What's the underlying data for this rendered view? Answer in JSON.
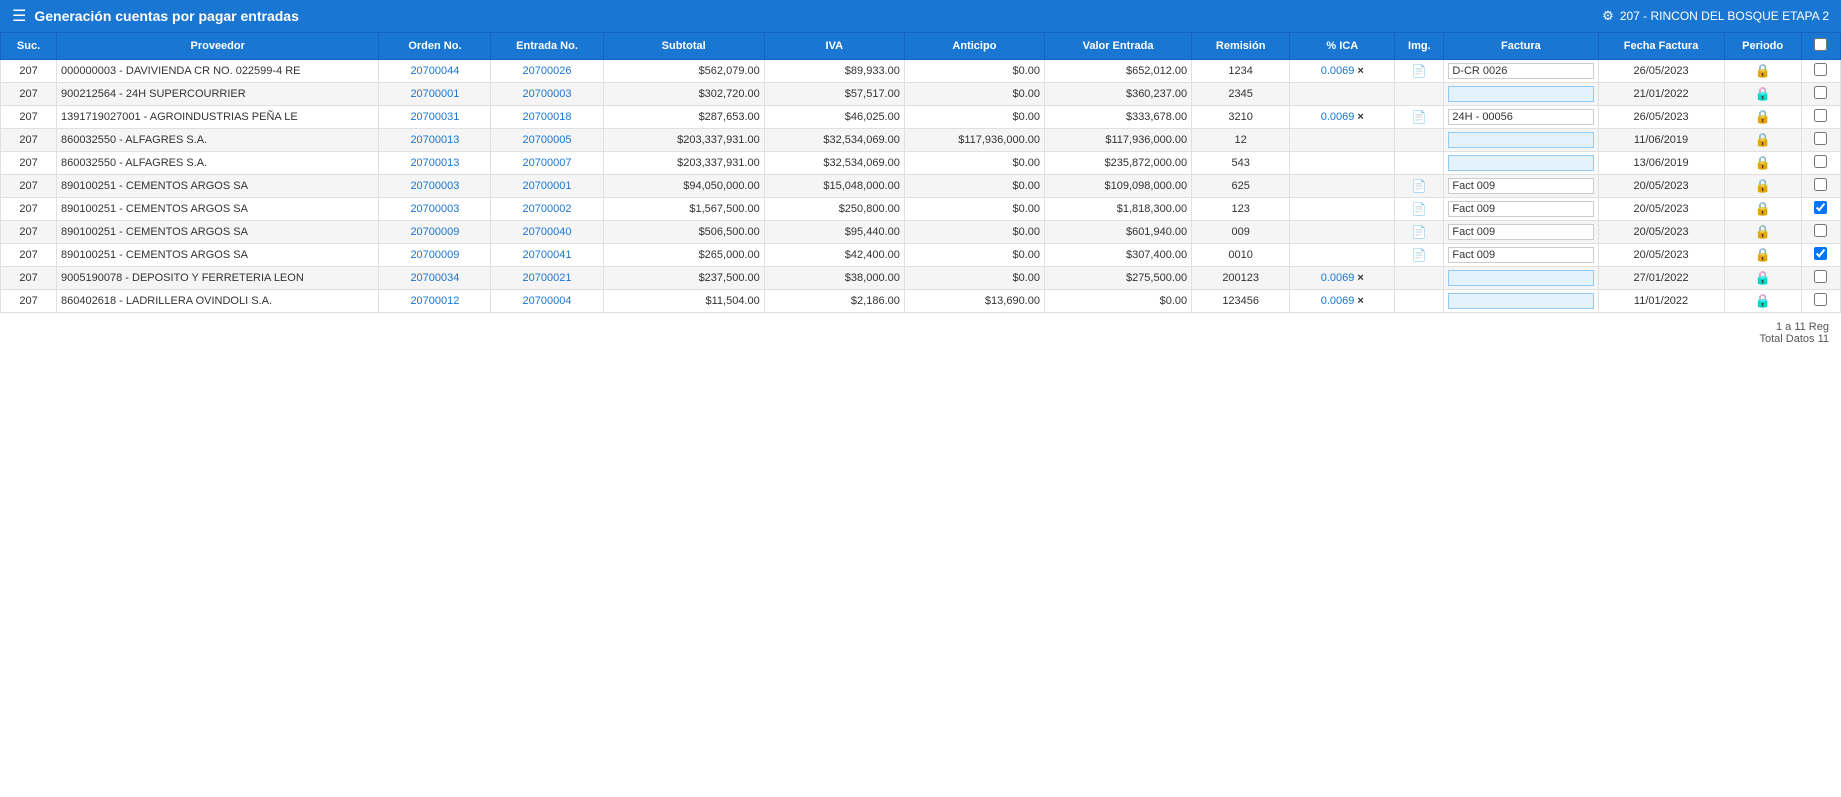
{
  "header": {
    "menu_icon": "☰",
    "title": "Generación cuentas por pagar entradas",
    "gear_icon": "⚙",
    "project_info": "207 - RINCON DEL BOSQUE ETAPA 2"
  },
  "table": {
    "columns": [
      "Suc.",
      "Proveedor",
      "Orden No.",
      "Entrada No.",
      "Subtotal",
      "IVA",
      "Anticipo",
      "Valor Entrada",
      "Remisión",
      "% ICA",
      "Img.",
      "Factura",
      "Fecha Factura",
      "Periodo",
      ""
    ],
    "rows": [
      {
        "suc": "207",
        "proveedor": "000000003 - DAVIVIENDA CR NO. 022599-4 RE",
        "orden": "20700044",
        "entrada": "20700026",
        "subtotal": "$562,079.00",
        "iva": "$89,933.00",
        "anticipo": "$0.00",
        "valor_entrada": "$652,012.00",
        "remision": "1234",
        "ica": "0.0069",
        "ica_x": true,
        "img": true,
        "factura": "D-CR 0026",
        "factura_editable": false,
        "fecha_factura": "26/05/2023",
        "periodo": "🔒",
        "periodo_type": "green",
        "check": false
      },
      {
        "suc": "207",
        "proveedor": "900212564 - 24H SUPERCOURRIER",
        "orden": "20700001",
        "entrada": "20700003",
        "subtotal": "$302,720.00",
        "iva": "$57,517.00",
        "anticipo": "$0.00",
        "valor_entrada": "$360,237.00",
        "remision": "2345",
        "ica": "",
        "ica_x": false,
        "img": false,
        "factura": "",
        "factura_editable": true,
        "fecha_factura": "21/01/2022",
        "periodo": "🔒",
        "periodo_type": "red",
        "check": false
      },
      {
        "suc": "207",
        "proveedor": "1391719027001 - AGROINDUSTRIAS PEÑA LE",
        "orden": "20700031",
        "entrada": "20700018",
        "subtotal": "$287,653.00",
        "iva": "$46,025.00",
        "anticipo": "$0.00",
        "valor_entrada": "$333,678.00",
        "remision": "3210",
        "ica": "0.0069",
        "ica_x": true,
        "img": true,
        "factura": "24H - 00056",
        "factura_editable": false,
        "fecha_factura": "26/05/2023",
        "periodo": "🔒",
        "periodo_type": "green",
        "check": false
      },
      {
        "suc": "207",
        "proveedor": "860032550 - ALFAGRES S.A.",
        "orden": "20700013",
        "entrada": "20700005",
        "subtotal": "$203,337,931.00",
        "iva": "$32,534,069.00",
        "anticipo": "$117,936,000.00",
        "valor_entrada": "$117,936,000.00",
        "remision": "12",
        "ica": "",
        "ica_x": false,
        "img": false,
        "factura": "",
        "factura_editable": true,
        "fecha_factura": "11/06/2019",
        "periodo": "🔒",
        "periodo_type": "green",
        "check": false
      },
      {
        "suc": "207",
        "proveedor": "860032550 - ALFAGRES S.A.",
        "orden": "20700013",
        "entrada": "20700007",
        "subtotal": "$203,337,931.00",
        "iva": "$32,534,069.00",
        "anticipo": "$0.00",
        "valor_entrada": "$235,872,000.00",
        "remision": "543",
        "ica": "",
        "ica_x": false,
        "img": false,
        "factura": "",
        "factura_editable": true,
        "fecha_factura": "13/06/2019",
        "periodo": "🔒",
        "periodo_type": "green",
        "check": false
      },
      {
        "suc": "207",
        "proveedor": "890100251 - CEMENTOS ARGOS SA",
        "orden": "20700003",
        "entrada": "20700001",
        "subtotal": "$94,050,000.00",
        "iva": "$15,048,000.00",
        "anticipo": "$0.00",
        "valor_entrada": "$109,098,000.00",
        "remision": "625",
        "ica": "",
        "ica_x": false,
        "img": true,
        "factura": "Fact 009",
        "factura_editable": false,
        "fecha_factura": "20/05/2023",
        "periodo": "🔒",
        "periodo_type": "green",
        "check": false
      },
      {
        "suc": "207",
        "proveedor": "890100251 - CEMENTOS ARGOS SA",
        "orden": "20700003",
        "entrada": "20700002",
        "subtotal": "$1,567,500.00",
        "iva": "$250,800.00",
        "anticipo": "$0.00",
        "valor_entrada": "$1,818,300.00",
        "remision": "123",
        "ica": "",
        "ica_x": false,
        "img": true,
        "factura": "Fact 009",
        "factura_editable": false,
        "fecha_factura": "20/05/2023",
        "periodo": "🔒",
        "periodo_type": "green",
        "check": true
      },
      {
        "suc": "207",
        "proveedor": "890100251 - CEMENTOS ARGOS SA",
        "orden": "20700009",
        "entrada": "20700040",
        "subtotal": "$506,500.00",
        "iva": "$95,440.00",
        "anticipo": "$0.00",
        "valor_entrada": "$601,940.00",
        "remision": "009",
        "ica": "",
        "ica_x": false,
        "img": true,
        "factura": "Fact 009",
        "factura_editable": false,
        "fecha_factura": "20/05/2023",
        "periodo": "🔒",
        "periodo_type": "green",
        "check": false
      },
      {
        "suc": "207",
        "proveedor": "890100251 - CEMENTOS ARGOS SA",
        "orden": "20700009",
        "entrada": "20700041",
        "subtotal": "$265,000.00",
        "iva": "$42,400.00",
        "anticipo": "$0.00",
        "valor_entrada": "$307,400.00",
        "remision": "0010",
        "ica": "",
        "ica_x": false,
        "img": true,
        "factura": "Fact 009",
        "factura_editable": false,
        "fecha_factura": "20/05/2023",
        "periodo": "🔒",
        "periodo_type": "green",
        "check": true
      },
      {
        "suc": "207",
        "proveedor": "9005190078 - DEPOSITO Y FERRETERIA LEON",
        "orden": "20700034",
        "entrada": "20700021",
        "subtotal": "$237,500.00",
        "iva": "$38,000.00",
        "anticipo": "$0.00",
        "valor_entrada": "$275,500.00",
        "remision": "200123",
        "ica": "0.0069",
        "ica_x": true,
        "img": false,
        "factura": "",
        "factura_editable": true,
        "fecha_factura": "27/01/2022",
        "periodo": "🔒",
        "periodo_type": "red",
        "check": false
      },
      {
        "suc": "207",
        "proveedor": "860402618 - LADRILLERA OVINDOLI S.A.",
        "orden": "20700012",
        "entrada": "20700004",
        "subtotal": "$11,504.00",
        "iva": "$2,186.00",
        "anticipo": "$13,690.00",
        "valor_entrada": "$0.00",
        "remision": "123456",
        "ica": "0.0069",
        "ica_x": true,
        "img": false,
        "factura": "",
        "factura_editable": true,
        "fecha_factura": "11/01/2022",
        "periodo": "🔒",
        "periodo_type": "red",
        "check": false
      }
    ]
  },
  "pagination": {
    "line1": "1 a 11 Reg",
    "line2": "Total Datos 11"
  }
}
